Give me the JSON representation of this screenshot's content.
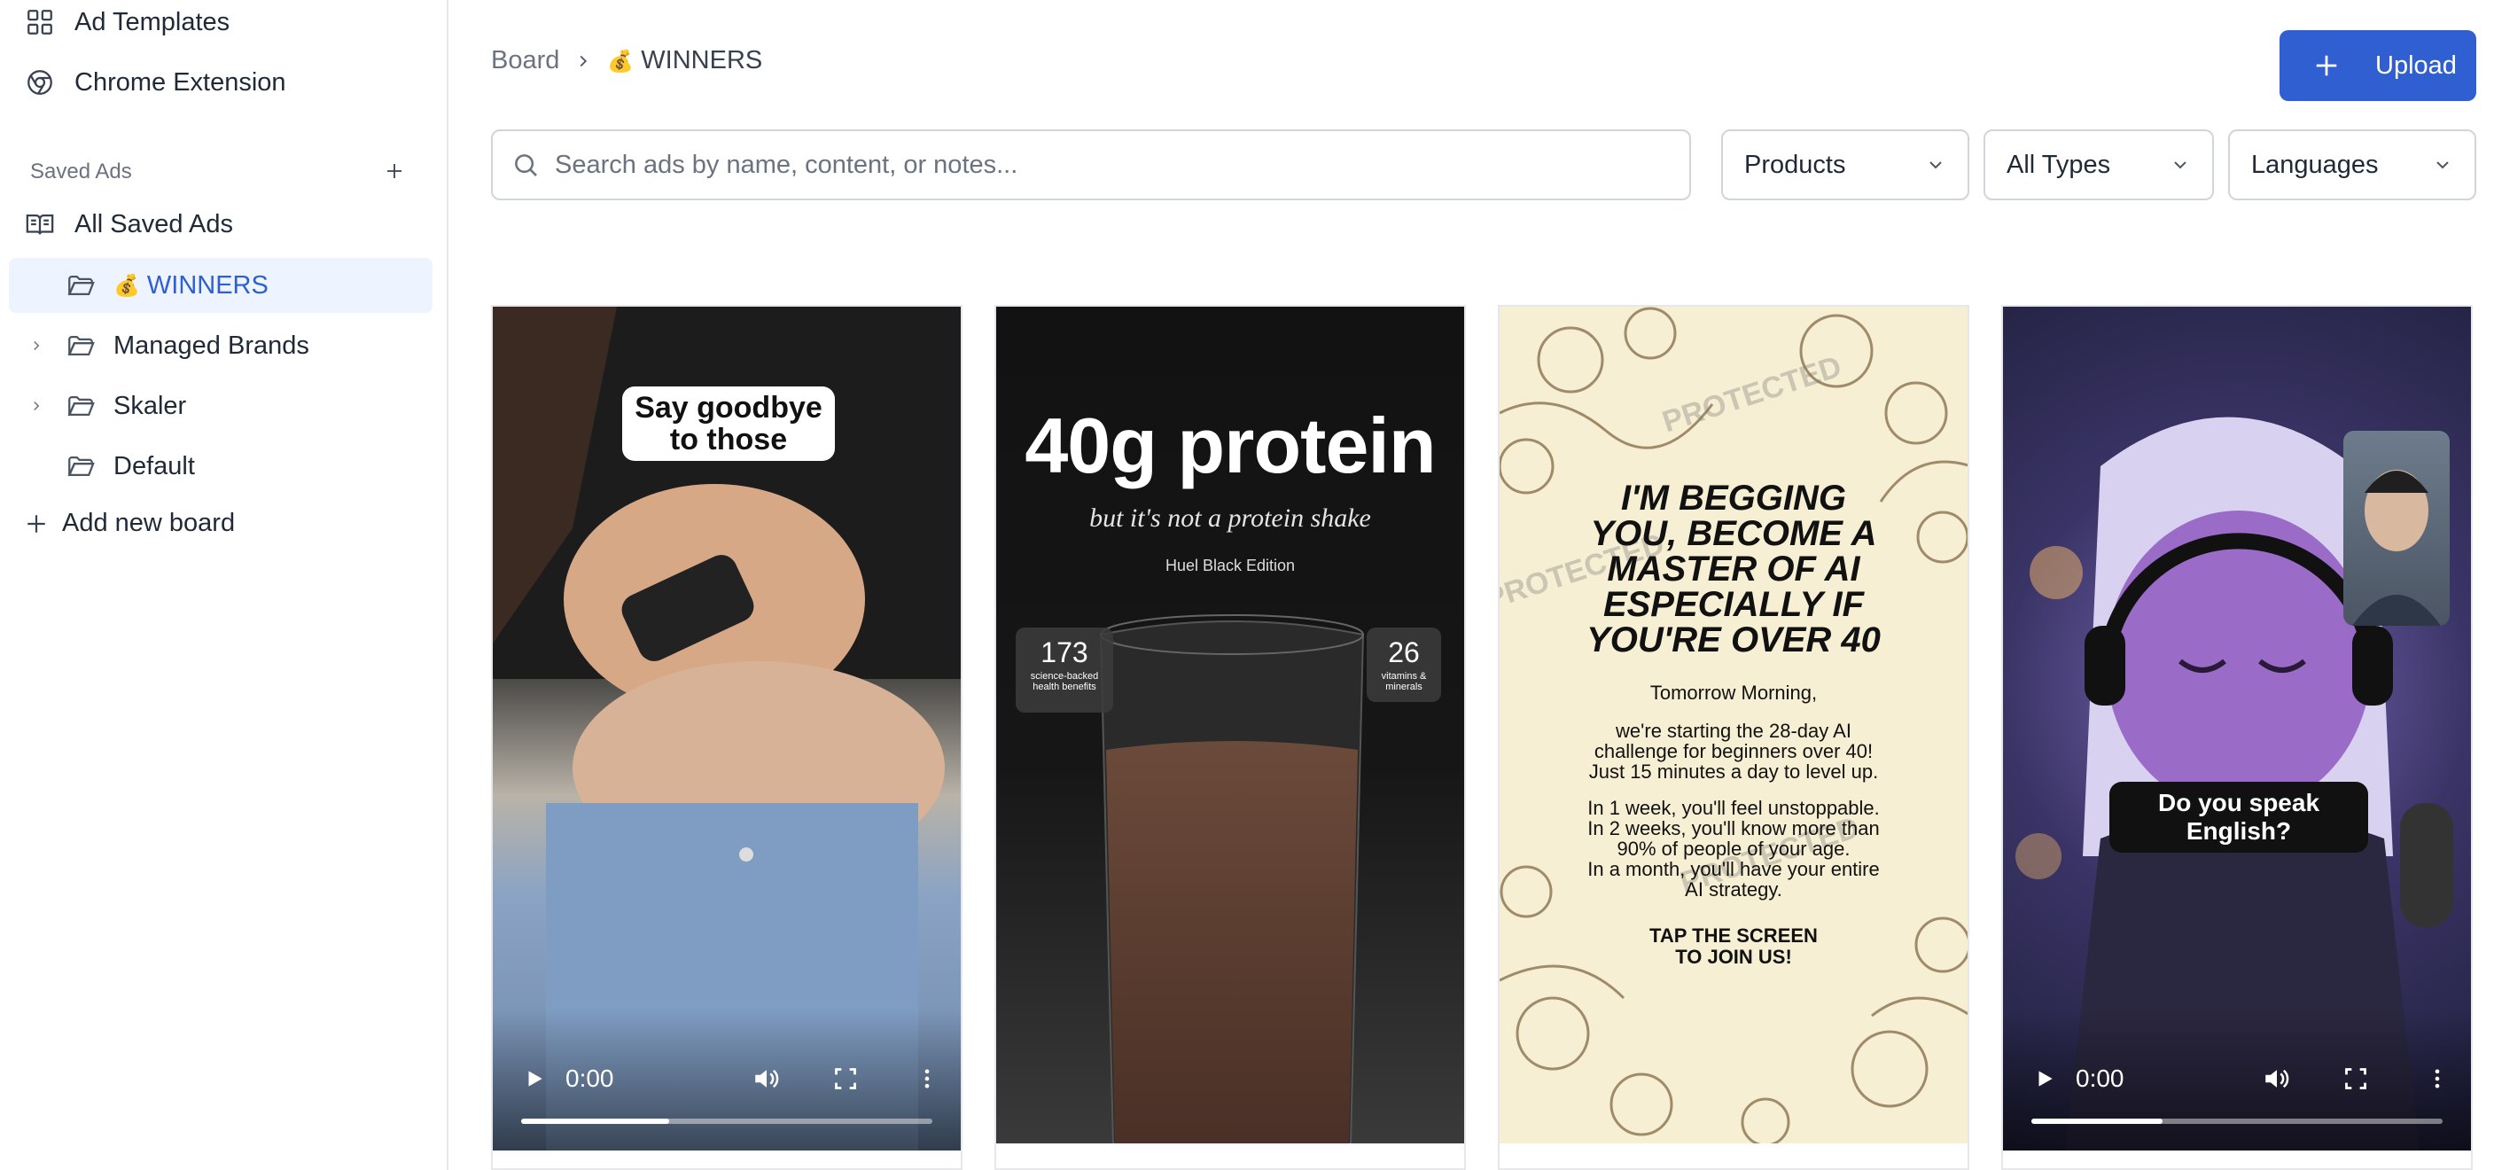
{
  "sidebar": {
    "ad_templates": "Ad Templates",
    "chrome_extension": "Chrome Extension",
    "saved_ads_label": "Saved Ads",
    "all_saved_ads": "All Saved Ads",
    "boards": [
      {
        "label": "WINNERS",
        "emoji": "💰",
        "active": true,
        "expandable": false
      },
      {
        "label": "Managed Brands",
        "expandable": true
      },
      {
        "label": "Skaler",
        "expandable": true
      },
      {
        "label": "Default",
        "expandable": false
      }
    ],
    "add_new_board": "Add new board"
  },
  "header": {
    "breadcrumb_root": "Board",
    "breadcrumb_emoji": "💰",
    "breadcrumb_current": "WINNERS",
    "upload_label": "Upload"
  },
  "filters": {
    "search_placeholder": "Search ads by name, content, or notes...",
    "products": "Products",
    "types": "All Types",
    "languages": "Languages"
  },
  "cards": [
    {
      "type": "video",
      "sticker": [
        "Say goodbye",
        "to those"
      ],
      "time": "0:00",
      "progress": 0.36
    },
    {
      "type": "image",
      "headline": "40g protein",
      "subhead": "but it's not a protein shake",
      "brand": "Huel Black Edition",
      "stat_left_value": "173",
      "stat_left_label": "science-backed health benefits",
      "stat_right_value": "26",
      "stat_right_label": "vitamins & minerals"
    },
    {
      "type": "image",
      "watermark": "PROTECTED",
      "headline_lines": [
        "I'M BEGGING",
        "YOU, BECOME A",
        "MASTER OF AI",
        "ESPECIALLY IF",
        "YOU'RE OVER 40"
      ],
      "body_lines": [
        "Tomorrow Morning,",
        "",
        "we're starting the 28-day AI",
        "challenge for beginners over 40!",
        "Just 15 minutes a day to level up.",
        "",
        "In 1 week, you'll feel unstoppable.",
        "In 2 weeks, you'll know more than",
        "90% of people of your age.",
        "In a month, you'll have your entire",
        "AI strategy."
      ],
      "cta_lines": [
        "TAP THE SCREEN",
        "TO JOIN US!"
      ]
    },
    {
      "type": "video",
      "caption": "Do you speak English?",
      "time": "0:00",
      "progress": 0.32
    }
  ],
  "colors": {
    "accent": "#2f5fd0",
    "active_bg": "#eef4ff",
    "border": "#d1d5db"
  }
}
